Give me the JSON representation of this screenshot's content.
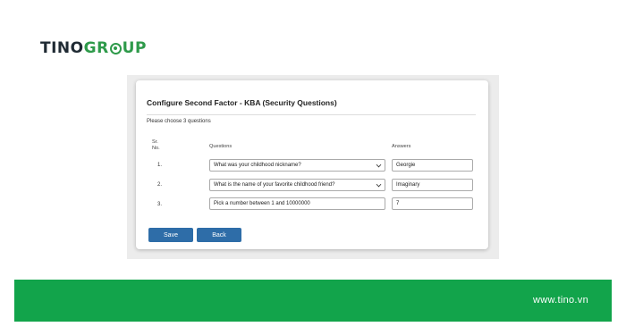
{
  "brand": {
    "part1": "TINO",
    "part2a": "GR",
    "part2b": "UP"
  },
  "form": {
    "title": "Configure Second Factor - KBA (Security Questions)",
    "instruction": "Please choose 3 questions",
    "headers": {
      "sr_line1": "Sr.",
      "sr_line2": "No.",
      "questions": "Questions",
      "answers": "Answers"
    },
    "rows": [
      {
        "num": "1.",
        "question": "What was your childhood nickname?",
        "answer": "Georgie",
        "type": "select"
      },
      {
        "num": "2.",
        "question": "What is the name of your favorite childhood friend?",
        "answer": "Imaginary",
        "type": "select"
      },
      {
        "num": "3.",
        "question": "Pick a number between 1 and 10000000",
        "answer": "7",
        "type": "text"
      }
    ],
    "save_label": "Save",
    "back_label": "Back",
    "button_color": "#2e6da8"
  },
  "footer": {
    "url": "www.tino.vn",
    "color": "#12a44b"
  }
}
